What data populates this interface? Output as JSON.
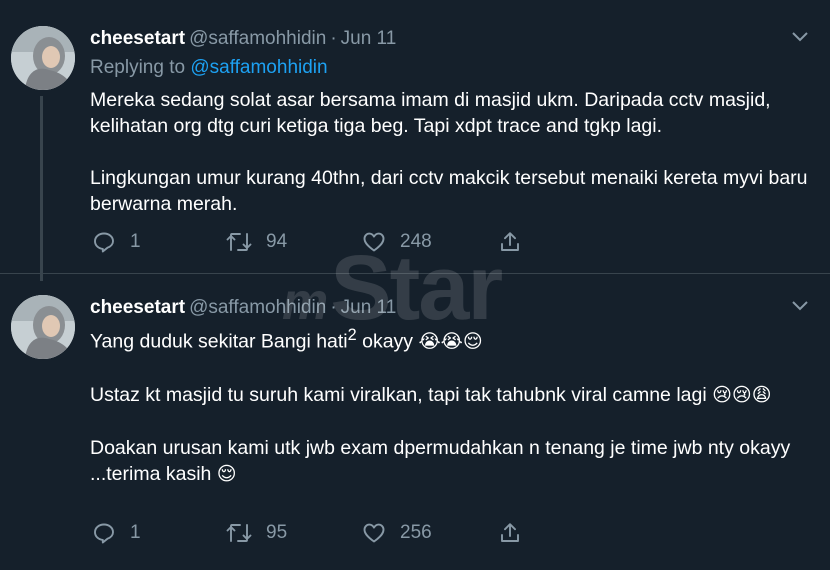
{
  "colors": {
    "background": "#15202b",
    "text": "#ffffff",
    "secondary_text": "#8899a6",
    "link": "#1da1f2",
    "divider": "#38444d"
  },
  "tweets": [
    {
      "display_name": "cheesetart",
      "handle": "@saffamohhidin",
      "separator": "·",
      "date": "Jun 11",
      "replying_prefix": "Replying to",
      "replying_to": "@saffamohhidin",
      "paragraphs": [
        "Mereka sedang solat asar bersama imam di masjid ukm. Daripada cctv masjid, kelihatan org dtg curi ketiga tiga beg. Tapi xdpt trace and tgkp lagi.",
        "Lingkungan umur kurang 40thn, dari cctv makcik tersebut menaiki kereta myvi baru berwarna merah."
      ],
      "reply_count": "1",
      "retweet_count": "94",
      "like_count": "248",
      "icons": [
        "reply-icon",
        "retweet-icon",
        "like-icon",
        "share-icon",
        "caret-down-icon"
      ]
    },
    {
      "display_name": "cheesetart",
      "handle": "@saffamohhidin",
      "separator": "·",
      "date": "Jun 11",
      "p1_text": "Yang duduk sekitar Bangi hati",
      "p1_sup": "2",
      "p1_tail": " okayy ",
      "p1_emoji": "😭😭😌",
      "p2_text": "Ustaz kt masjid tu suruh kami viralkan, tapi tak tahubnk viral camne lagi ",
      "p2_emoji": "😢😢😩",
      "p3_text": "Doakan urusan kami utk jwb exam dpermudahkan n tenang je time jwb nty okayy ...terima kasih ",
      "p3_emoji": "😌",
      "reply_count": "1",
      "retweet_count": "95",
      "like_count": "256",
      "icons": [
        "reply-icon",
        "retweet-icon",
        "like-icon",
        "share-icon",
        "caret-down-icon"
      ]
    }
  ],
  "watermark": {
    "prefix": "m",
    "brand": "Star"
  }
}
